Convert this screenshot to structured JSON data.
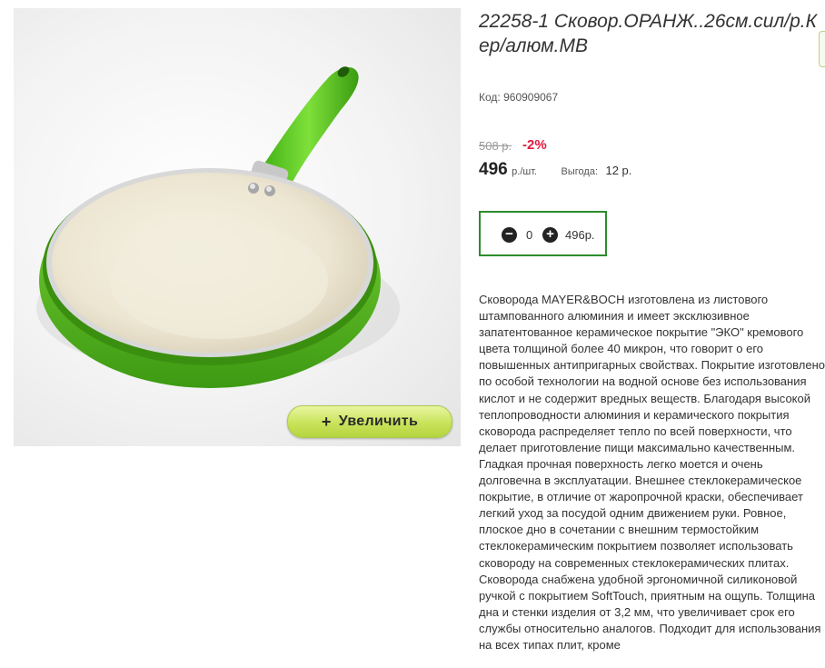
{
  "product": {
    "title": "22258-1 Сковор.ОРАНЖ..26см.сил/р.Кер/алюм.МВ",
    "code_label": "Код:",
    "code": "960909067",
    "old_price": "508 р.",
    "discount": "-2%",
    "price": "496",
    "unit": "р./шт.",
    "savings_label": "Выгода:",
    "savings_value": "12 р.",
    "quantity": "0",
    "quantity_sum": "496р.",
    "zoom_label": "Увеличить",
    "description": "Сковорода MAYER&BOCH изготовлена из листового штампованного алюминия и имеет эксклюзивное запатентованное керамическое покрытие \"ЭКО\" кремового цвета толщиной более 40 микрон, что говорит о его повышенных антипригарных свойствах. Покрытие изготовлено по особой технологии на водной основе без использования кислот и не содержит вредных веществ. Благодаря высокой теплопроводности алюминия и керамического покрытия сковорода распределяет тепло по всей поверхности, что делает приготовление пищи максимально качественным. Гладкая прочная поверхность легко моется и очень долговечна в эксплуатации. Внешнее стеклокерамическое покрытие, в отличие от жаропрочной краски, обеспечивает легкий уход за посудой одним движением руки. Ровное, плоское дно в сочетании с внешним термостойким стеклокерамическим покрытием позволяет использовать сковороду на современных стеклокерамических плитах. Сковорода снабжена удобной эргономичной силиконовой ручкой с покрытием SoftTouch, приятным на ощупь. Толщина дна и стенки изделия от 3,2 мм, что увеличивает срок его службы относительно аналогов. Подходит для использования на всех типах плит, кроме"
  },
  "colors": {
    "accent_green": "#2d8c2d",
    "discount_red": "#e2173d",
    "pan_green": "#5cc021",
    "pan_cream": "#efe9d8"
  },
  "icons": {
    "minus": "minus-circle-icon",
    "plus": "plus-circle-icon",
    "zoom": "plus-icon"
  }
}
